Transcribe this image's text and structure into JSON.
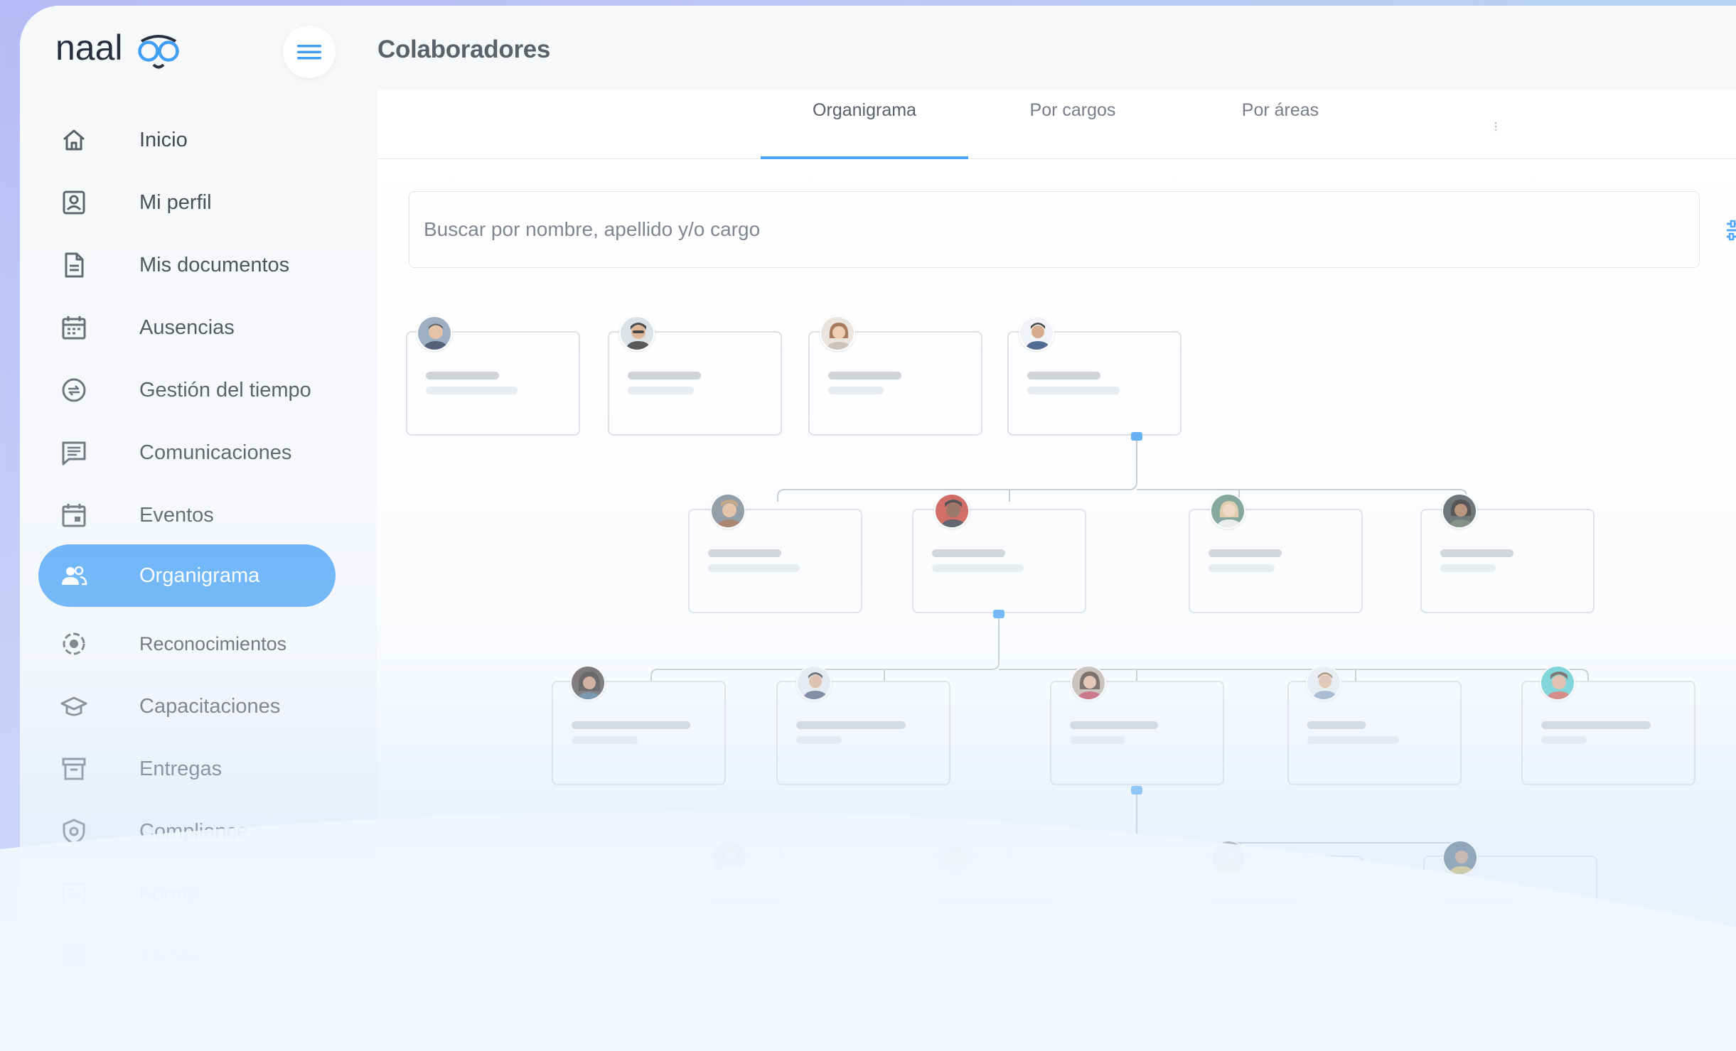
{
  "logo": {
    "text": "naaloo"
  },
  "header": {
    "title": "Colaboradores"
  },
  "sidebar": {
    "items": [
      {
        "label": "Inicio",
        "icon": "home-icon"
      },
      {
        "label": "Mi perfil",
        "icon": "profile-icon"
      },
      {
        "label": "Mis documentos",
        "icon": "document-icon"
      },
      {
        "label": "Ausencias",
        "icon": "calendar-icon"
      },
      {
        "label": "Gestión del tiempo",
        "icon": "time-icon"
      },
      {
        "label": "Comunicaciones",
        "icon": "message-icon"
      },
      {
        "label": "Eventos",
        "icon": "event-icon"
      },
      {
        "label": "Organigrama",
        "icon": "people-icon",
        "active": true
      },
      {
        "label": "Reconocimientos",
        "icon": "recognition-icon"
      },
      {
        "label": "Capacitaciones",
        "icon": "graduation-icon"
      },
      {
        "label": "Entregas",
        "icon": "archive-icon"
      },
      {
        "label": "Compliance",
        "icon": "shield-icon"
      },
      {
        "label": "Forms",
        "icon": "forms-icon"
      },
      {
        "label": "Tareas",
        "icon": "tasks-icon"
      }
    ]
  },
  "tabs": [
    {
      "label": "Organigrama",
      "active": true
    },
    {
      "label": "Por cargos"
    },
    {
      "label": "Por áreas"
    }
  ],
  "search": {
    "placeholder": "Buscar por nombre, apellido y/o cargo"
  },
  "colors": {
    "accent": "#3b9cf5",
    "title": "#555d66",
    "background_gradient": "#b3bbf6"
  }
}
